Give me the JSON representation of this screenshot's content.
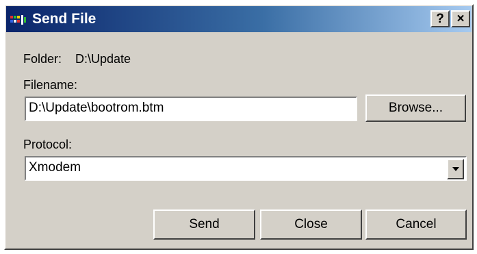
{
  "window": {
    "title": "Send File",
    "help_glyph": "?",
    "close_glyph": "×",
    "app_icon": "terminal-app-icon"
  },
  "folder": {
    "label": "Folder:",
    "value": "D:\\Update"
  },
  "filename": {
    "label": "Filename:",
    "value": "D:\\Update\\bootrom.btm",
    "browse_label": "Browse..."
  },
  "protocol": {
    "label": "Protocol:",
    "selected": "Xmodem",
    "dropdown_icon": "chevron-down-icon"
  },
  "buttons": {
    "send": "Send",
    "close": "Close",
    "cancel": "Cancel"
  },
  "colors": {
    "title_gradient_start": "#0a246a",
    "title_gradient_end": "#a6caf0",
    "face": "#d4d0c8"
  }
}
